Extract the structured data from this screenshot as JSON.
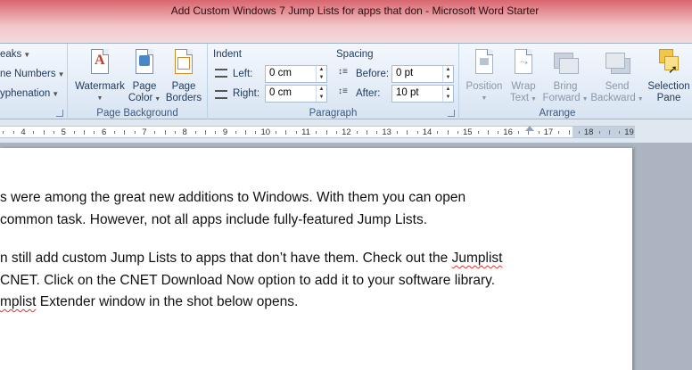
{
  "window": {
    "title": "Add Custom Windows 7 Jump Lists for apps that don  -  Microsoft Word Starter"
  },
  "ribbon": {
    "page_setup_partial": {
      "breaks": "eaks",
      "line_numbers": "ne Numbers",
      "hyphenation": "yphenation"
    },
    "page_background": {
      "label": "Page Background",
      "watermark": "Watermark",
      "page_color_line1": "Page",
      "page_color_line2": "Color",
      "page_borders_line1": "Page",
      "page_borders_line2": "Borders"
    },
    "paragraph": {
      "label": "Paragraph",
      "indent_title": "Indent",
      "left_label": "Left:",
      "left_value": "0 cm",
      "right_label": "Right:",
      "right_value": "0 cm",
      "spacing_title": "Spacing",
      "before_label": "Before:",
      "before_value": "0 pt",
      "after_label": "After:",
      "after_value": "10 pt"
    },
    "arrange": {
      "label": "Arrange",
      "position": "Position",
      "wrap_line1": "Wrap",
      "wrap_line2": "Text",
      "bring_line1": "Bring",
      "bring_line2": "Forward",
      "send_line1": "Send",
      "send_line2": "Backward",
      "selection_line1": "Selection",
      "selection_line2": "Pane"
    }
  },
  "ruler": {
    "numbers": [
      "4",
      "5",
      "6",
      "7",
      "8",
      "9",
      "10",
      "11",
      "12",
      "13",
      "14",
      "15",
      "16",
      "17",
      "18",
      "19"
    ]
  },
  "document": {
    "p1_line1": "s were among the great new additions to Windows. With them you can open",
    "p1_line2": "common task. However, not all apps include fully-featured Jump Lists.",
    "p2_line1_a": "n still add custom Jump Lists to apps that don’t have them. Check out the ",
    "p2_line1_b": "Jumplist",
    "p2_line2": "CNET. Click on the CNET Download Now option to add it to your software library.",
    "p2_line3_a": "mplist",
    "p2_line3_b": " Extender window in the shot below opens."
  },
  "colors": {
    "titlebar": "#e6959b",
    "ribbon": "#e3ecf7",
    "workspace": "#abb4c0",
    "spellcheck": "#e23131"
  }
}
